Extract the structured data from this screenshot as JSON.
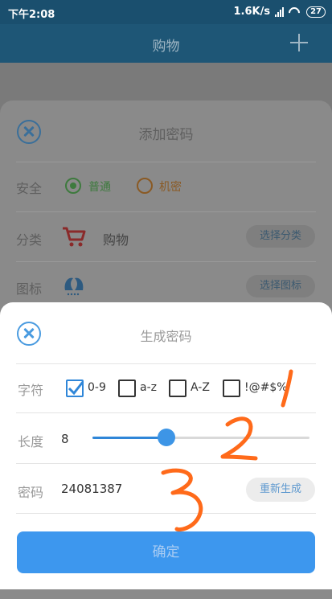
{
  "status_bar": {
    "time": "下午2:08",
    "speed": "1.6K/s",
    "network": "4G",
    "battery": "27"
  },
  "app_bar": {
    "title": "购物"
  },
  "background_sheet": {
    "title": "添加密码",
    "security": {
      "label": "安全",
      "option_normal": "普通",
      "option_secret": "机密"
    },
    "category": {
      "label": "分类",
      "value": "购物",
      "button": "选择分类"
    },
    "icon_row": {
      "label": "图标",
      "button": "选择图标"
    }
  },
  "generator_sheet": {
    "title": "生成密码",
    "chars": {
      "label": "字符",
      "options": [
        {
          "label": "0-9",
          "checked": true
        },
        {
          "label": "a-z",
          "checked": false
        },
        {
          "label": "A-Z",
          "checked": false
        },
        {
          "label": "!@#$%",
          "checked": false
        }
      ]
    },
    "length": {
      "label": "长度",
      "value": "8",
      "fraction": 0.34
    },
    "password": {
      "label": "密码",
      "value": "24081387",
      "regenerate": "重新生成"
    },
    "confirm": "确定"
  },
  "annotations": [
    "1",
    "2",
    "3"
  ],
  "colors": {
    "accent": "#3d97ee",
    "annotation": "#ff6a1a",
    "appbar": "#1e5676"
  }
}
